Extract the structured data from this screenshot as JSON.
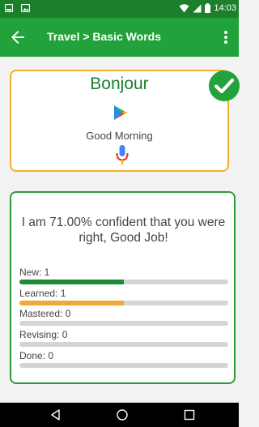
{
  "status_bar": {
    "time": "14:03"
  },
  "app_bar": {
    "title": "Travel > Basic Words"
  },
  "word_card": {
    "word": "Bonjour",
    "translation": "Good Morning"
  },
  "stats_card": {
    "confidence_text": "I am 71.00% confident that you were right, Good Job!",
    "stats": [
      {
        "label": "New: 1",
        "progress": 0.5,
        "color": "#1e8a35"
      },
      {
        "label": "Learned: 1",
        "progress": 0.5,
        "color": "#f0a83a"
      },
      {
        "label": "Mastered: 0",
        "progress": 0,
        "color": "#1e8a35"
      },
      {
        "label": "Revising: 0",
        "progress": 0,
        "color": "#1e8a35"
      },
      {
        "label": "Done: 0",
        "progress": 0,
        "color": "#1e8a35"
      }
    ]
  },
  "colors": {
    "status_bar": "#1b7f2c",
    "app_bar": "#21a23a",
    "word_card_border": "#f0b12b",
    "stats_card_border": "#2d9b3d"
  },
  "icons": {
    "back": "arrow-left-icon",
    "menu": "more-vert-icon",
    "check": "check-icon",
    "play": "play-icon",
    "mic": "mic-icon"
  }
}
